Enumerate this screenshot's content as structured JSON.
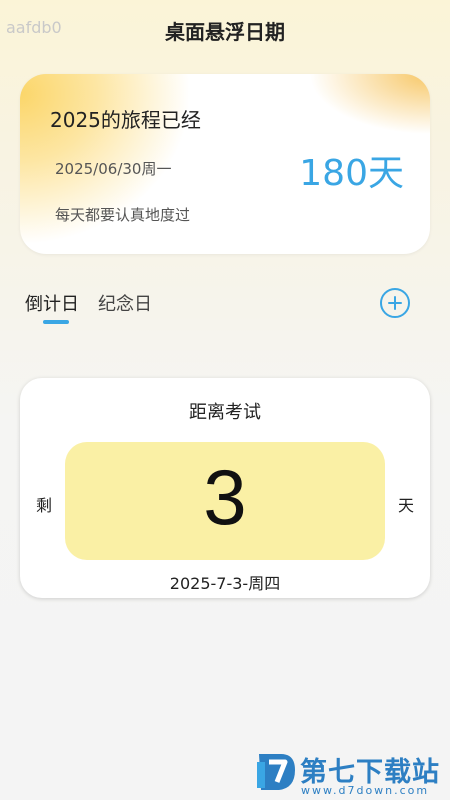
{
  "header": {
    "id_text": "aafdb0",
    "title": "桌面悬浮日期"
  },
  "year_card": {
    "progress_label": "2025的旅程已经",
    "date": "2025/06/30周一",
    "days_elapsed": "180天",
    "motto": "每天都要认真地度过"
  },
  "tabs": {
    "items": [
      {
        "label": "倒计日",
        "active": true
      },
      {
        "label": "纪念日",
        "active": false
      }
    ],
    "add_icon": "plus-circle-icon",
    "accent_color": "#3aa6e4"
  },
  "countdown": {
    "event_title": "距离考试",
    "prefix": "剩",
    "days_left": "3",
    "suffix": "天",
    "target_date": "2025-7-3-周四",
    "box_color": "#faf0a5"
  },
  "watermark": {
    "logo_icon": "d7-logo-icon",
    "site_name": "第七下载站",
    "site_url": "www.d7down.com",
    "color": "#2d7fc3"
  }
}
